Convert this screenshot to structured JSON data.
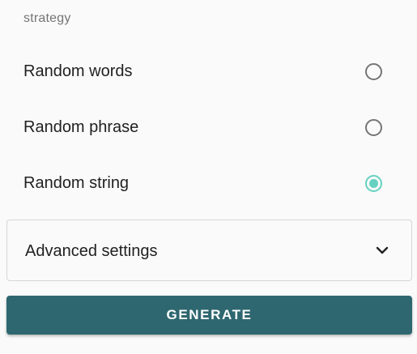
{
  "strategy": {
    "label": "strategy",
    "options": [
      {
        "label": "Random words",
        "selected": false
      },
      {
        "label": "Random phrase",
        "selected": false
      },
      {
        "label": "Random string",
        "selected": true
      }
    ]
  },
  "advanced": {
    "label": "Advanced settings",
    "icon": "chevron-down-icon",
    "expanded": false
  },
  "actions": {
    "generate_label": "GENERATE"
  },
  "colors": {
    "accent": "#66d1c1",
    "primary_button": "#2e6770",
    "radio_unchecked": "#757575",
    "text": "#212121",
    "label_muted": "#757575",
    "background": "#fafafa"
  }
}
